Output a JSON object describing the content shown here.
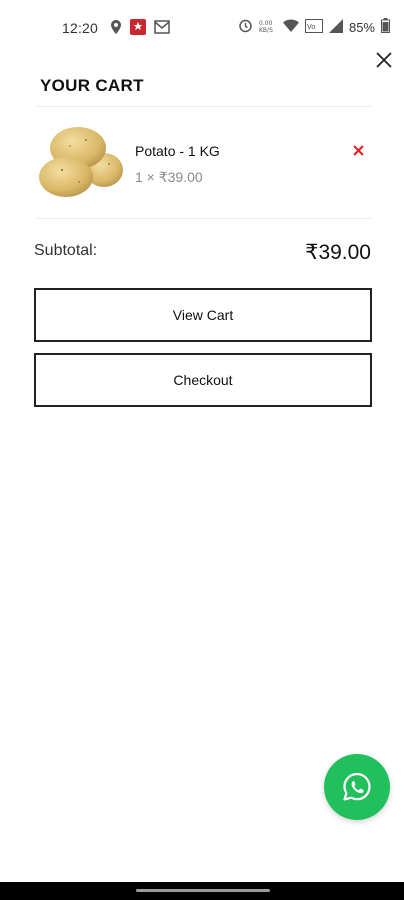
{
  "status_bar": {
    "time": "12:20",
    "battery_percent": "85%",
    "speed": "0.00 KB/S",
    "icons_left": [
      "location-pin-icon",
      "red-app-icon",
      "gmail-icon"
    ],
    "icons_right": [
      "alarm-icon",
      "network-speed-icon",
      "wifi-icon",
      "volte-icon",
      "signal-icon",
      "battery-icon"
    ]
  },
  "cart": {
    "title": "YOUR CART",
    "items": [
      {
        "name": "Potato - 1 KG",
        "qty_price": "1 × ₹39.00",
        "image": "potato-image",
        "remove_icon": "remove-x-icon"
      }
    ],
    "subtotal_label": "Subtotal:",
    "subtotal_value": "₹39.00",
    "view_cart_label": "View Cart",
    "checkout_label": "Checkout"
  },
  "colors": {
    "remove": "#e02020",
    "whatsapp": "#22c05d",
    "button_border": "#222222"
  },
  "fab": {
    "icon": "whatsapp-icon"
  }
}
